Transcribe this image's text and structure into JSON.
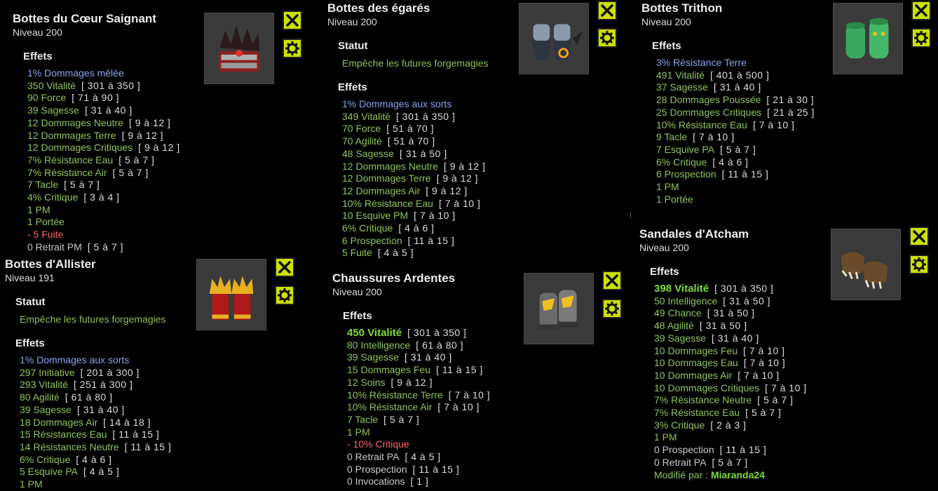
{
  "cards": [
    {
      "title": "Bottes du Cœur Saignant",
      "level": "Niveau  200",
      "effects_label": "Effets",
      "effects": [
        {
          "text": "1% Dommages mêlée",
          "range": "",
          "color": "blue"
        },
        {
          "text": "350 Vitalité",
          "range": "[ 301 à 350 ]",
          "color": "green"
        },
        {
          "text": "90 Force",
          "range": "[ 71 à 90 ]",
          "color": "green"
        },
        {
          "text": "39 Sagesse",
          "range": "[ 31 à 40 ]",
          "color": "green"
        },
        {
          "text": "12 Dommages Neutre",
          "range": "[ 9 à 12 ]",
          "color": "green"
        },
        {
          "text": "12 Dommages Terre",
          "range": "[ 9 à 12 ]",
          "color": "green"
        },
        {
          "text": "12 Dommages Critiques",
          "range": "[ 9 à 12 ]",
          "color": "green"
        },
        {
          "text": "7% Résistance Eau",
          "range": "[ 5 à 7 ]",
          "color": "green"
        },
        {
          "text": "7% Résistance Air",
          "range": "[ 5 à 7 ]",
          "color": "green"
        },
        {
          "text": "7 Tacle",
          "range": "[ 5 à 7 ]",
          "color": "green"
        },
        {
          "text": "4% Critique",
          "range": "[ 3 à 4 ]",
          "color": "green"
        },
        {
          "text": "1 PM",
          "range": "",
          "color": "green"
        },
        {
          "text": "1 Portée",
          "range": "",
          "color": "green"
        },
        {
          "text": "- 5 Fuite",
          "range": "",
          "color": "red"
        },
        {
          "text": "0 Retrait PM",
          "range": "[ 5 à 7 ]",
          "color": "gray"
        }
      ]
    },
    {
      "title": "Bottes d'Allister",
      "level": "Niveau  191",
      "status_label": "Statut",
      "status_text": "Empêche les futures forgemagies",
      "effects_label": "Effets",
      "effects": [
        {
          "text": "1% Dommages aux sorts",
          "range": "",
          "color": "blue"
        },
        {
          "text": "297 Initiative",
          "range": "[ 201 à 300 ]",
          "color": "green"
        },
        {
          "text": "293 Vitalité",
          "range": "[ 251 à 300 ]",
          "color": "green"
        },
        {
          "text": "80 Agilité",
          "range": "[ 61 à 80 ]",
          "color": "green"
        },
        {
          "text": "39 Sagesse",
          "range": "[ 31 à 40 ]",
          "color": "green"
        },
        {
          "text": "18 Dommages Air",
          "range": "[ 14 à 18 ]",
          "color": "green"
        },
        {
          "text": "15 Résistances Eau",
          "range": "[ 11 à 15 ]",
          "color": "green"
        },
        {
          "text": "14 Résistances Neutre",
          "range": "[ 11 à 15 ]",
          "color": "green"
        },
        {
          "text": "6% Critique",
          "range": "[ 4 à 6 ]",
          "color": "green"
        },
        {
          "text": "5 Esquive PA",
          "range": "[ 4 à 5 ]",
          "color": "green"
        },
        {
          "text": "1 PM",
          "range": "",
          "color": "green"
        }
      ]
    },
    {
      "title": "Bottes des égarés",
      "level": "Niveau  200",
      "status_label": "Statut",
      "status_text": "Empêche les futures forgemagies",
      "effects_label": "Effets",
      "effects": [
        {
          "text": "1% Dommages aux sorts",
          "range": "",
          "color": "blue"
        },
        {
          "text": "349 Vitalité",
          "range": "[ 301 à 350 ]",
          "color": "green"
        },
        {
          "text": "70 Force",
          "range": "[ 51 à 70 ]",
          "color": "green"
        },
        {
          "text": "70 Agilité",
          "range": "[ 51 à 70 ]",
          "color": "green"
        },
        {
          "text": "48 Sagesse",
          "range": "[ 31 à 50 ]",
          "color": "green"
        },
        {
          "text": "12 Dommages Neutre",
          "range": "[ 9 à 12 ]",
          "color": "green"
        },
        {
          "text": "12 Dommages Terre",
          "range": "[ 9 à 12 ]",
          "color": "green"
        },
        {
          "text": "12 Dommages Air",
          "range": "[ 9 à 12 ]",
          "color": "green"
        },
        {
          "text": "10% Résistance Eau",
          "range": "[ 7 à 10 ]",
          "color": "green"
        },
        {
          "text": "10 Esquive PM",
          "range": "[ 7 à 10 ]",
          "color": "green"
        },
        {
          "text": "6% Critique",
          "range": "[ 4 à 6 ]",
          "color": "green"
        },
        {
          "text": "6 Prospection",
          "range": "[ 11 à 15 ]",
          "color": "green"
        },
        {
          "text": "5 Fuite",
          "range": "[ 4 à 5 ]",
          "color": "green"
        }
      ]
    },
    {
      "title": "Chaussures Ardentes",
      "level": "Niveau  200",
      "effects_label": "Effets",
      "effects": [
        {
          "text": "450 Vitalité",
          "range": "[ 301 à 350 ]",
          "color": "bright"
        },
        {
          "text": "80 Intelligence",
          "range": "[ 61 à 80 ]",
          "color": "green"
        },
        {
          "text": "39 Sagesse",
          "range": "[ 31 à 40 ]",
          "color": "green"
        },
        {
          "text": "15 Dommages Feu",
          "range": "[ 11 à 15 ]",
          "color": "green"
        },
        {
          "text": "12 Soins",
          "range": "[ 9 à 12 ]",
          "color": "green"
        },
        {
          "text": "10% Résistance Terre",
          "range": "[ 7 à 10 ]",
          "color": "green"
        },
        {
          "text": "10% Résistance Air",
          "range": "[ 7 à 10 ]",
          "color": "green"
        },
        {
          "text": "7 Tacle",
          "range": "[ 5 à 7 ]",
          "color": "green"
        },
        {
          "text": "1 PM",
          "range": "",
          "color": "green"
        },
        {
          "text": "- 10% Critique",
          "range": "",
          "color": "red"
        },
        {
          "text": "0 Retrait PA",
          "range": "[ 4 à 5 ]",
          "color": "gray"
        },
        {
          "text": "0 Prospection",
          "range": "[ 11 à 15 ]",
          "color": "gray"
        },
        {
          "text": "0 Invocations",
          "range": "[ 1 ]",
          "color": "gray"
        }
      ]
    },
    {
      "title": "Bottes Trithon",
      "level": "Niveau  200",
      "effects_label": "Effets",
      "effects": [
        {
          "text": "3% Résistance Terre",
          "range": "",
          "color": "blue"
        },
        {
          "text": "491 Vitalité",
          "range": "[ 401 à 500 ]",
          "color": "green"
        },
        {
          "text": "37 Sagesse",
          "range": "[ 31 à 40 ]",
          "color": "green"
        },
        {
          "text": "28 Dommages Poussée",
          "range": "[ 21 à 30 ]",
          "color": "green"
        },
        {
          "text": "25 Dommages Critiques",
          "range": "[ 21 à 25 ]",
          "color": "green"
        },
        {
          "text": "10% Résistance Eau",
          "range": "[ 7 à 10 ]",
          "color": "green"
        },
        {
          "text": "9 Tacle",
          "range": "[ 7 à 10 ]",
          "color": "green"
        },
        {
          "text": "7 Esquive PA",
          "range": "[ 5 à 7 ]",
          "color": "green"
        },
        {
          "text": "6% Critique",
          "range": "[ 4 à 6 ]",
          "color": "green"
        },
        {
          "text": "6 Prospection",
          "range": "[ 11 à 15 ]",
          "color": "green"
        },
        {
          "text": "1 PM",
          "range": "",
          "color": "green"
        },
        {
          "text": "1 Portée",
          "range": "",
          "color": "green"
        }
      ]
    },
    {
      "title": "Sandales d'Atcham",
      "level": "Niveau  200",
      "effects_label": "Effets",
      "effects": [
        {
          "text": "398 Vitalité",
          "range": "[ 301 à 350 ]",
          "color": "bright"
        },
        {
          "text": "50 Intelligence",
          "range": "[ 31 à 50 ]",
          "color": "green"
        },
        {
          "text": "49 Chance",
          "range": "[ 31 à 50 ]",
          "color": "green"
        },
        {
          "text": "48 Agilité",
          "range": "[ 31 à 50 ]",
          "color": "green"
        },
        {
          "text": "39 Sagesse",
          "range": "[ 31 à 40 ]",
          "color": "green"
        },
        {
          "text": "10 Dommages Feu",
          "range": "[ 7 à 10 ]",
          "color": "green"
        },
        {
          "text": "10 Dommages Eau",
          "range": "[ 7 à 10 ]",
          "color": "green"
        },
        {
          "text": "10 Dommages Air",
          "range": "[ 7 à 10 ]",
          "color": "green"
        },
        {
          "text": "10 Dommages Critiques",
          "range": "[ 7 à 10 ]",
          "color": "green"
        },
        {
          "text": "7% Résistance Neutre",
          "range": "[ 5 à 7 ]",
          "color": "green"
        },
        {
          "text": "7% Résistance Eau",
          "range": "[ 5 à 7 ]",
          "color": "green"
        },
        {
          "text": "3% Critique",
          "range": "[ 2 à 3 ]",
          "color": "green"
        },
        {
          "text": "1 PM",
          "range": "",
          "color": "green"
        },
        {
          "text": "0 Prospection",
          "range": "[ 11 à 15 ]",
          "color": "gray"
        },
        {
          "text": "0 Retrait PA",
          "range": "[ 5 à 7 ]",
          "color": "gray"
        }
      ],
      "modified_by_label": "Modifié par : ",
      "modified_by_name": "Miaranda24"
    }
  ],
  "icons": {
    "close": "close-x-icon",
    "options": "gear-icon"
  },
  "colors": {
    "button": "#cde000",
    "green": "#8fc55e",
    "blue": "#8aa4ee",
    "red": "#ff6464",
    "gray": "#c9c9c9",
    "bright": "#7ddc3a"
  }
}
